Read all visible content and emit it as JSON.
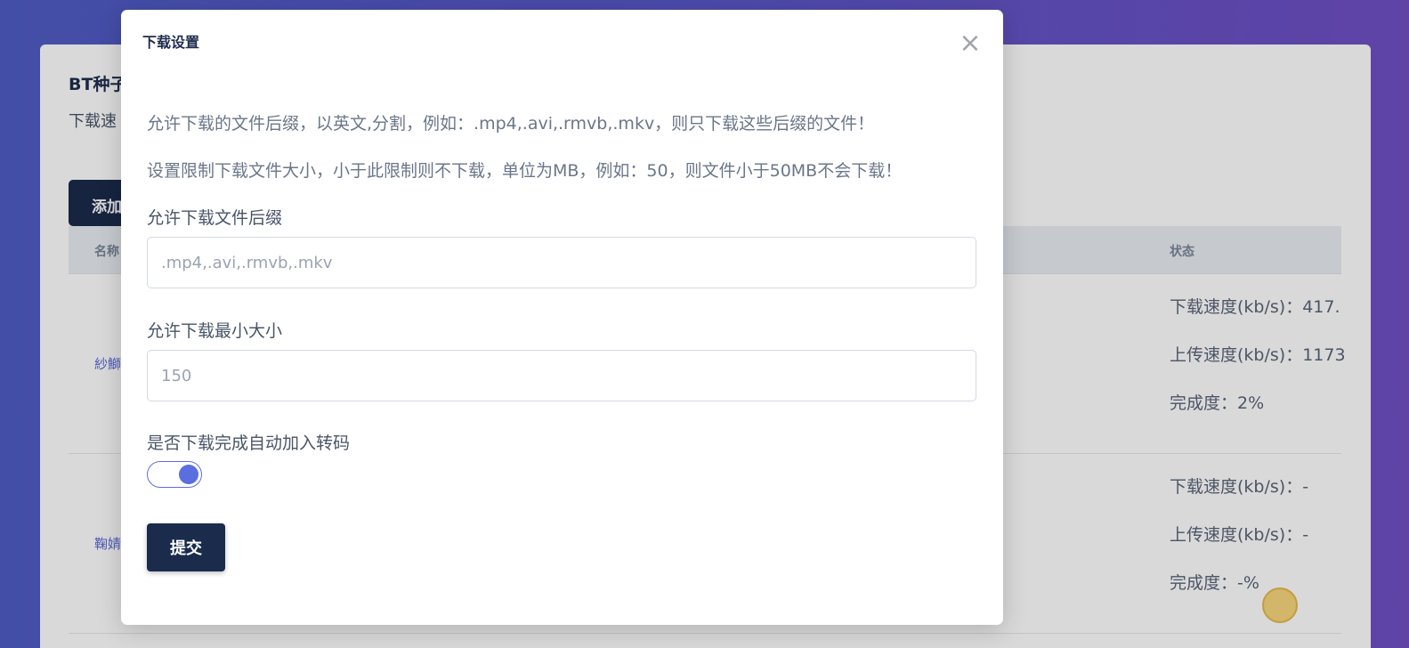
{
  "background": {
    "title": "BT种子",
    "subtitle": "下载速",
    "add_button": "添加",
    "table": {
      "columns": [
        {
          "label": "名称"
        },
        {
          "label": "状态"
        }
      ],
      "rows": [
        {
          "name": "紗鰤",
          "status": [
            "下载速度(kb/s)：417.",
            "上传速度(kb/s)：1173",
            "完成度：2%"
          ]
        },
        {
          "name": "鞠婧",
          "status": [
            "下载速度(kb/s)：-",
            "上传速度(kb/s)：-",
            "完成度：-%"
          ]
        }
      ]
    }
  },
  "modal": {
    "title": "下载设置",
    "close_icon": "close-icon",
    "hints": [
      "允许下载的文件后缀，以英文,分割，例如：.mp4,.avi,.rmvb,.mkv，则只下载这些后缀的文件！",
      "设置限制下载文件大小，小于此限制则不下载，单位为MB，例如：50，则文件小于50MB不会下载！"
    ],
    "suffix_field": {
      "label": "允许下载文件后缀",
      "value": "",
      "placeholder": ".mp4,.avi,.rmvb,.mkv"
    },
    "min_size_field": {
      "label": "允许下载最小大小",
      "value": "",
      "placeholder": "150"
    },
    "auto_transcode": {
      "label": "是否下载完成自动加入转码",
      "enabled": true
    },
    "submit_label": "提交"
  },
  "colors": {
    "accent": "#5a6ee0",
    "primary_button": "#1a2b4c",
    "gradient_start": "#4f5cc4",
    "gradient_end": "#7050c4"
  }
}
